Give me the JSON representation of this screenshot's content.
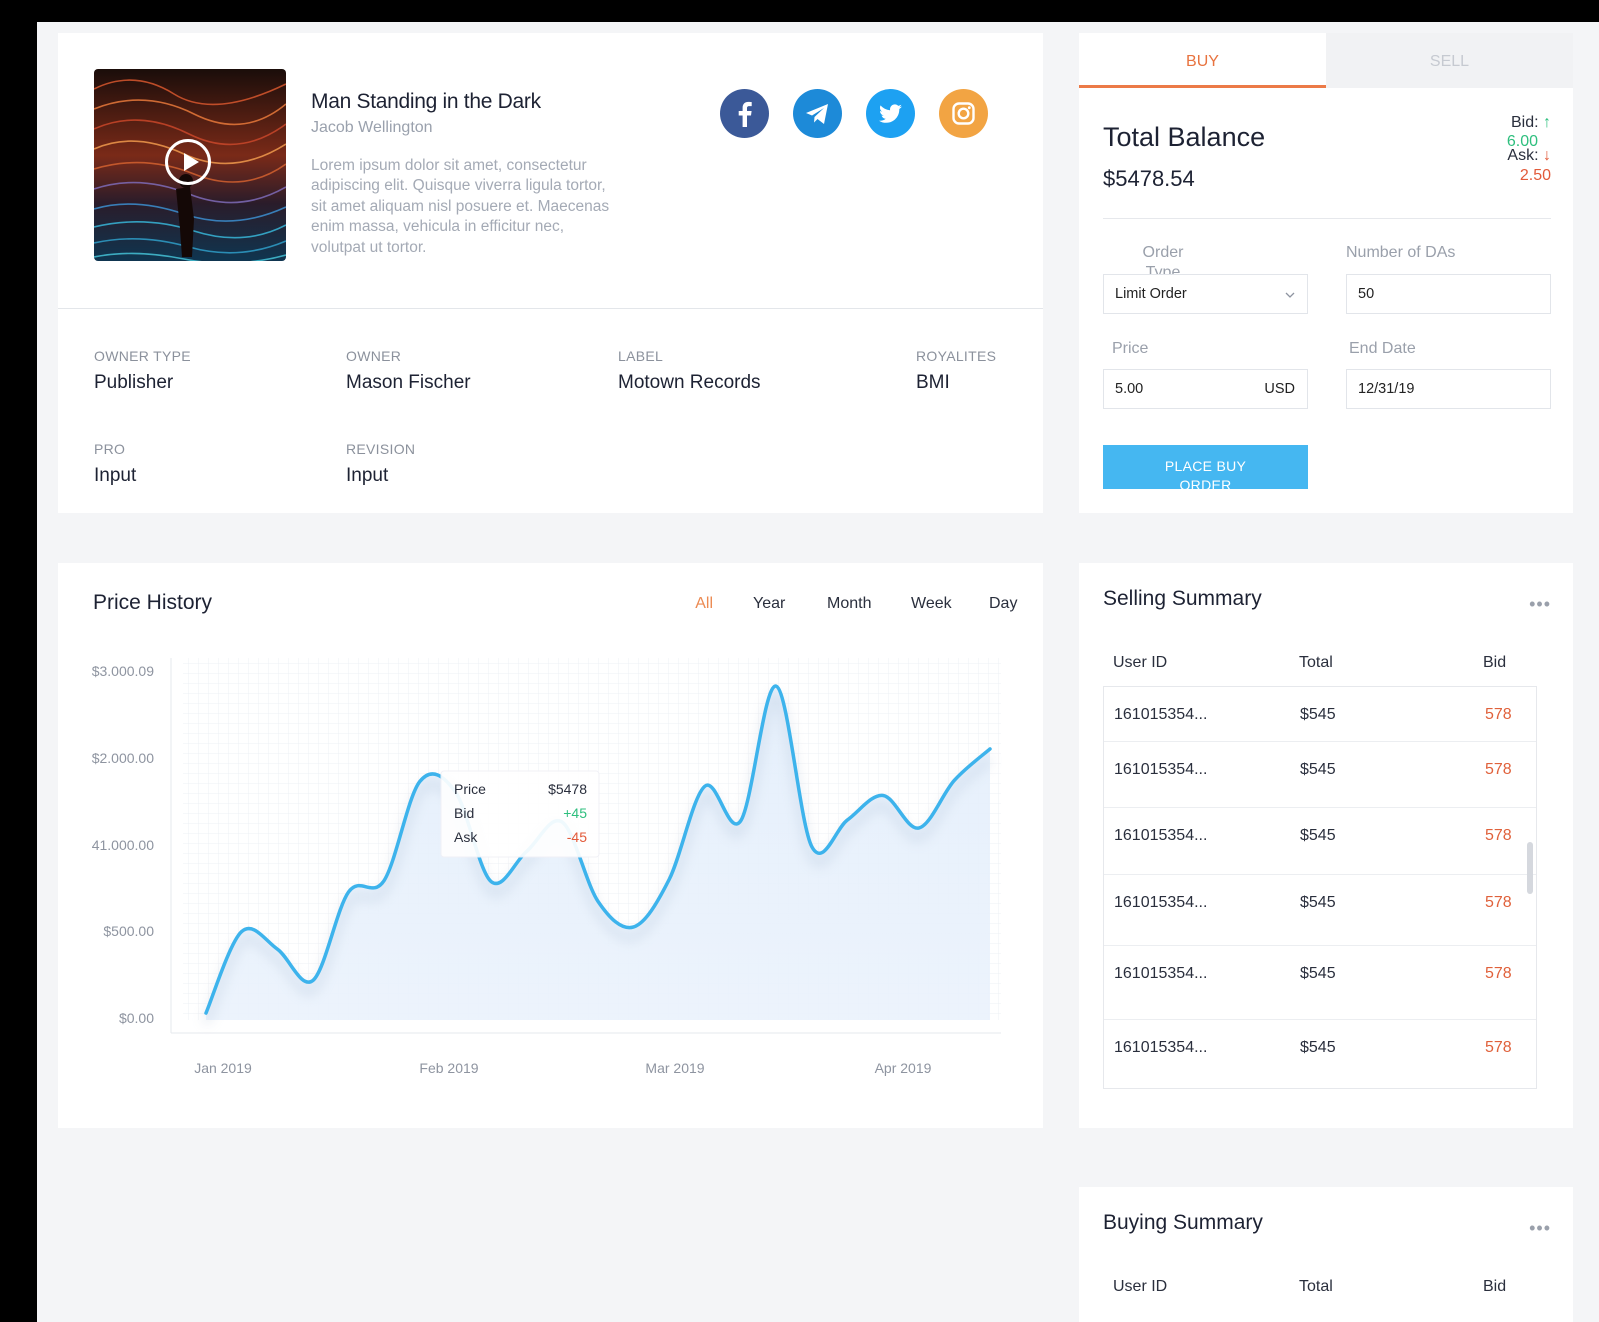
{
  "track": {
    "title": "Man Standing in the Dark",
    "artist": "Jacob Wellington",
    "description": "Lorem ipsum dolor sit amet, consectetur adipiscing elit. Quisque viverra ligula tortor, sit amet aliquam nisl posuere et. Maecenas enim massa, vehicula in efficitur nec, volutpat ut tortor.",
    "social": [
      {
        "name": "facebook-icon",
        "color": "#3b5998"
      },
      {
        "name": "telegram-icon",
        "color": "#1d8ad8"
      },
      {
        "name": "twitter-icon",
        "color": "#1da1f2"
      },
      {
        "name": "instagram-icon",
        "color": "#f2a443"
      }
    ],
    "meta": {
      "owner_type_label": "OWNER TYPE",
      "owner_type": "Publisher",
      "owner_label": "OWNER",
      "owner": "Mason Fischer",
      "label_label": "LABEL",
      "label": "Motown Records",
      "royalites_label": "ROYALITES",
      "royalites": "BMI",
      "pro_label": "PRO",
      "pro": "Input",
      "revision_label": "REVISION",
      "revision": "Input"
    }
  },
  "order": {
    "tab_buy": "BUY",
    "tab_sell": "SELL",
    "total_balance_label": "Total Balance",
    "total_balance": "$5478.54",
    "bid_label": "Bid:",
    "bid_value": "6.00",
    "ask_label": "Ask:",
    "ask_value": "2.50",
    "order_type_label": "Order Type",
    "order_type_value": "Limit Order",
    "num_das_label": "Number of DAs",
    "num_das_value": "50",
    "price_label": "Price",
    "price_value": "5.00",
    "price_currency": "USD",
    "end_date_label": "End Date",
    "end_date_value": "12/31/19",
    "place_button": "PLACE BUY ORDER",
    "colors": {
      "accent": "#ec7a47",
      "bid": "#2ebf7e",
      "ask": "#e25a3a",
      "button": "#45b7f1"
    }
  },
  "price_history": {
    "title": "Price History",
    "ranges": [
      "All",
      "Year",
      "Month",
      "Week",
      "Day"
    ],
    "active_range": "All",
    "tooltip": {
      "price_label": "Price",
      "price_value": "$5478",
      "bid_label": "Bid",
      "bid_value": "+45",
      "ask_label": "Ask",
      "ask_value": "-45"
    }
  },
  "chart_data": {
    "type": "line",
    "title": "Price History",
    "xlabel": "",
    "ylabel": "",
    "y_ticks": [
      "$3.000.09",
      "$2.000.00",
      "41.000.00",
      "$500.00",
      "$0.00"
    ],
    "x_ticks": [
      "Jan 2019",
      "Feb 2019",
      "Mar 2019",
      "Apr 2019"
    ],
    "grid": true,
    "series": [
      {
        "x": [
          0,
          5,
          10,
          15,
          20,
          25,
          30,
          35,
          40,
          45,
          50,
          55,
          60,
          65,
          70,
          75,
          80,
          85,
          90,
          95,
          100,
          105,
          110
        ],
        "values": [
          0.06,
          0.76,
          0.61,
          0.34,
          1.1,
          1.2,
          2.05,
          1.96,
          1.19,
          1.45,
          1.7,
          1.02,
          0.8,
          1.21,
          2.01,
          1.71,
          2.87,
          1.49,
          1.72,
          1.93,
          1.65,
          2.06,
          2.33
        ]
      }
    ],
    "line_color": "#3db3ec"
  },
  "selling_summary": {
    "title": "Selling Summary",
    "columns": [
      "User ID",
      "Total",
      "Bid"
    ],
    "rows": [
      [
        "161015354...",
        "$545",
        "578"
      ],
      [
        "161015354...",
        "$545",
        "578"
      ],
      [
        "161015354...",
        "$545",
        "578"
      ],
      [
        "161015354...",
        "$545",
        "578"
      ],
      [
        "161015354...",
        "$545",
        "578"
      ],
      [
        "161015354...",
        "$545",
        "578"
      ]
    ]
  },
  "buying_summary": {
    "title": "Buying Summary",
    "columns": [
      "User ID",
      "Total",
      "Bid"
    ]
  },
  "more_icon": "•••"
}
